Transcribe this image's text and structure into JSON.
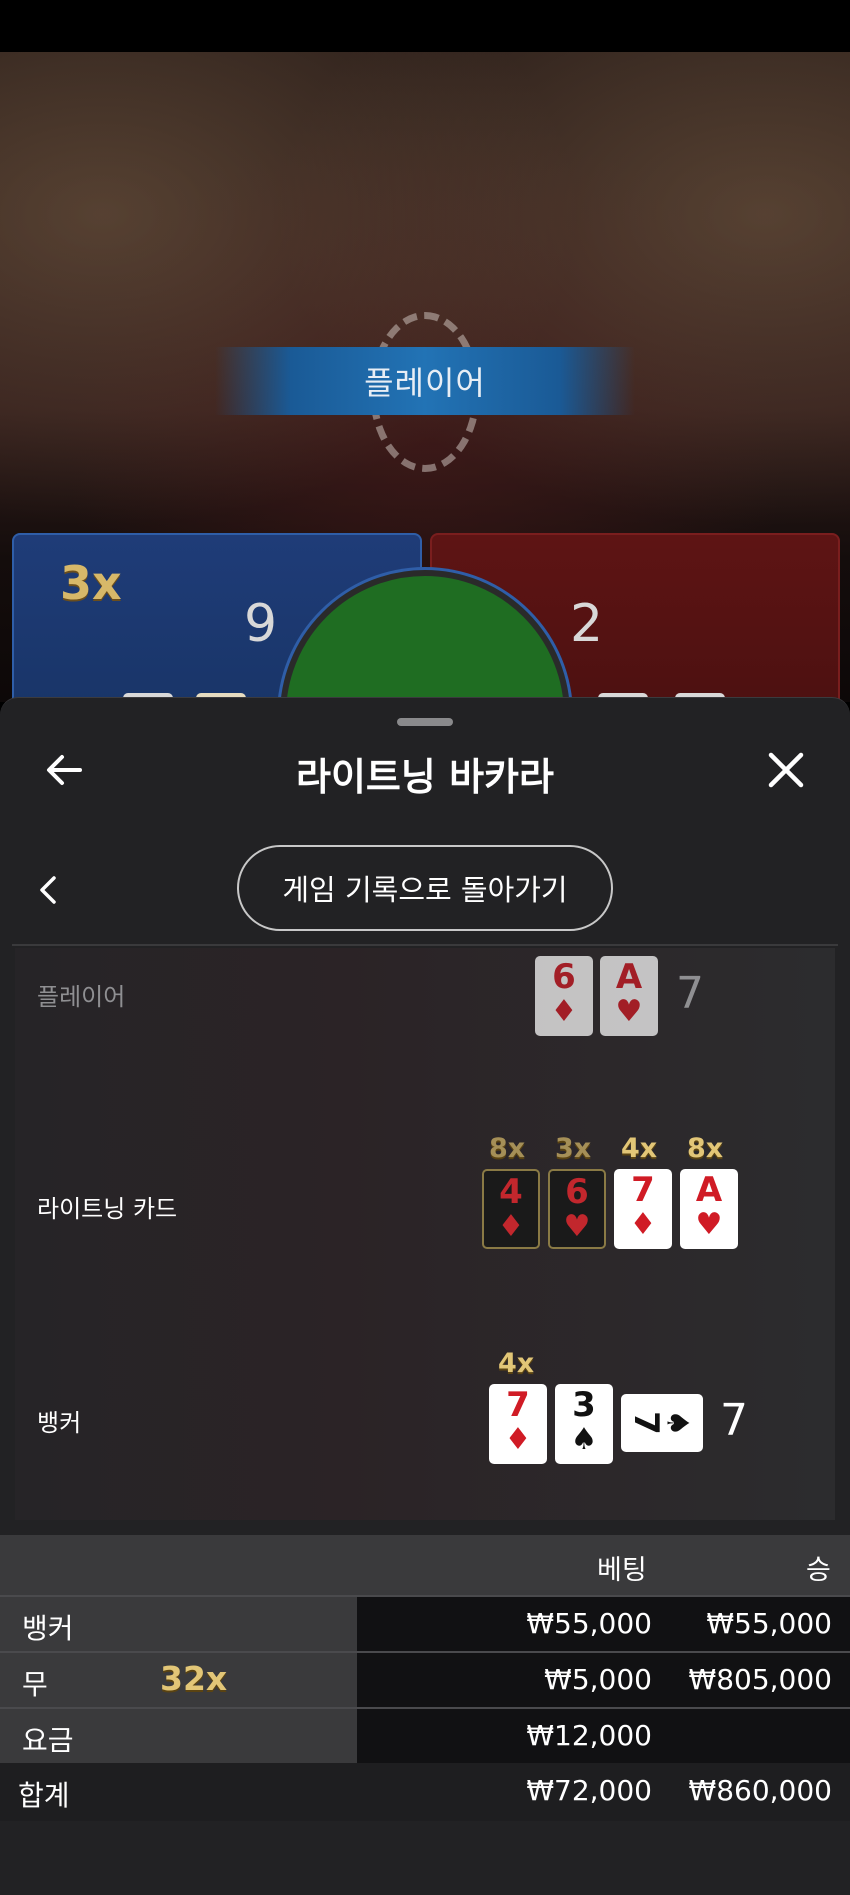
{
  "background": {
    "banner_label": "플레이어",
    "player_multiplier": "3x",
    "player_score": "9",
    "banker_score": "2"
  },
  "sheet": {
    "title": "라이트닝 바카라",
    "history_button": "게임 기록으로 돌아가기"
  },
  "result": {
    "player": {
      "label": "플레이어",
      "cards": [
        {
          "rank": "6",
          "suit": "♦",
          "color": "red"
        },
        {
          "rank": "A",
          "suit": "♥",
          "color": "red"
        }
      ],
      "total": "7"
    },
    "lightning": {
      "label": "라이트닝 카드",
      "cards": [
        {
          "rank": "4",
          "suit": "♦",
          "multiplier": "8x"
        },
        {
          "rank": "6",
          "suit": "♥",
          "multiplier": "3x"
        },
        {
          "rank": "7",
          "suit": "♦",
          "multiplier": "4x"
        },
        {
          "rank": "A",
          "suit": "♥",
          "multiplier": "8x"
        }
      ]
    },
    "banker": {
      "label": "뱅커",
      "cards": [
        {
          "rank": "7",
          "suit": "♦",
          "color": "red",
          "multiplier": "4x"
        },
        {
          "rank": "3",
          "suit": "♠",
          "color": "black"
        },
        {
          "rank": "7",
          "suit": "♠",
          "color": "black"
        }
      ],
      "total": "7"
    }
  },
  "bet_table": {
    "headers": {
      "bet": "베팅",
      "win": "승"
    },
    "rows": [
      {
        "label": "뱅커",
        "bet": "₩55,000",
        "win": "₩55,000",
        "multiplier": ""
      },
      {
        "label": "무",
        "bet": "₩5,000",
        "win": "₩805,000",
        "multiplier": "32x"
      },
      {
        "label": "요금",
        "bet": "₩12,000",
        "win": ""
      }
    ],
    "total": {
      "label": "합계",
      "bet": "₩72,000",
      "win": "₩860,000"
    }
  },
  "icons": {
    "back": "arrow-left-icon",
    "close": "close-icon",
    "chevron": "chevron-left-icon"
  }
}
